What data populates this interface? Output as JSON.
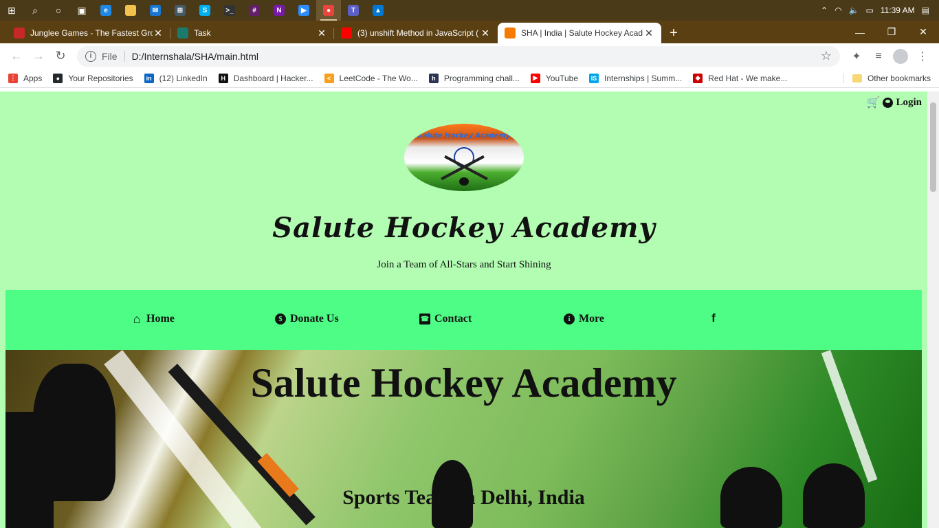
{
  "taskbar": {
    "time": "11:39 AM",
    "apps": [
      {
        "name": "edge",
        "color": "#1e88e5",
        "glyph": "e"
      },
      {
        "name": "file-explorer",
        "color": "#f2c14e",
        "glyph": ""
      },
      {
        "name": "mail",
        "color": "#1976d2",
        "glyph": "✉"
      },
      {
        "name": "store",
        "color": "#455a64",
        "glyph": "⊞"
      },
      {
        "name": "skype",
        "color": "#00aff0",
        "glyph": "S"
      },
      {
        "name": "terminal",
        "color": "#333333",
        "glyph": ">_"
      },
      {
        "name": "slack",
        "color": "#611f69",
        "glyph": "#"
      },
      {
        "name": "onenote",
        "color": "#7719aa",
        "glyph": "N"
      },
      {
        "name": "zoom",
        "color": "#2d8cff",
        "glyph": "▶"
      },
      {
        "name": "chrome",
        "color": "#e8453c",
        "glyph": "●"
      },
      {
        "name": "teams",
        "color": "#5b5fc7",
        "glyph": "T"
      },
      {
        "name": "photos",
        "color": "#0078d4",
        "glyph": "▲"
      }
    ]
  },
  "tabs": [
    {
      "title": "Junglee Games - The Fastest Gro",
      "icon_color": "#c62828",
      "active": false
    },
    {
      "title": "Task",
      "icon_color": "#1b7a6e",
      "active": false
    },
    {
      "title": "(3) unshift Method in JavaScript (",
      "icon_color": "#ff0000",
      "active": false
    },
    {
      "title": "SHA | India | Salute Hockey Acad",
      "icon_color": "#f57c00",
      "active": true
    }
  ],
  "address": {
    "scheme_label": "File",
    "url": "D:/Internshala/SHA/main.html"
  },
  "bookmarks": [
    {
      "label": "Apps",
      "icon_color": "#ea4335",
      "glyph": "⋮"
    },
    {
      "label": "Your Repositories",
      "icon_color": "#24292e",
      "glyph": "●"
    },
    {
      "label": "(12) LinkedIn",
      "icon_color": "#0a66c2",
      "glyph": "in"
    },
    {
      "label": "Dashboard | Hacker...",
      "icon_color": "#111111",
      "glyph": "H"
    },
    {
      "label": "LeetCode - The Wo...",
      "icon_color": "#f89f1b",
      "glyph": "<"
    },
    {
      "label": "Programming chall...",
      "icon_color": "#2c3454",
      "glyph": "h"
    },
    {
      "label": "YouTube",
      "icon_color": "#ff0000",
      "glyph": "▶"
    },
    {
      "label": "Internships | Summ...",
      "icon_color": "#00a5ec",
      "glyph": "IS"
    },
    {
      "label": "Red Hat - We make...",
      "icon_color": "#cc0000",
      "glyph": "◆"
    }
  ],
  "other_bookmarks": "Other bookmarks",
  "site": {
    "login_label": "Login",
    "logo_arc_text": "Salute Hockey Academy",
    "title": "Salute Hockey Academy",
    "tagline": "Join a Team of All-Stars and Start Shining",
    "nav": [
      {
        "label": "Home",
        "icon": "home-icon",
        "glyph": "⌂"
      },
      {
        "label": "Donate Us",
        "icon": "donate-icon",
        "glyph": "$"
      },
      {
        "label": "Contact",
        "icon": "contact-icon",
        "glyph": "☎"
      },
      {
        "label": "More",
        "icon": "info-icon",
        "glyph": "i"
      },
      {
        "label": "",
        "icon": "facebook-icon",
        "glyph": "f"
      }
    ],
    "hero_title": "Salute Hockey Academy",
    "hero_subtitle": "Sports Team in Delhi, India"
  },
  "colors": {
    "page_bg": "#b3fdb2",
    "nav_bg": "#4dfd85",
    "cart": "#f0a500"
  }
}
